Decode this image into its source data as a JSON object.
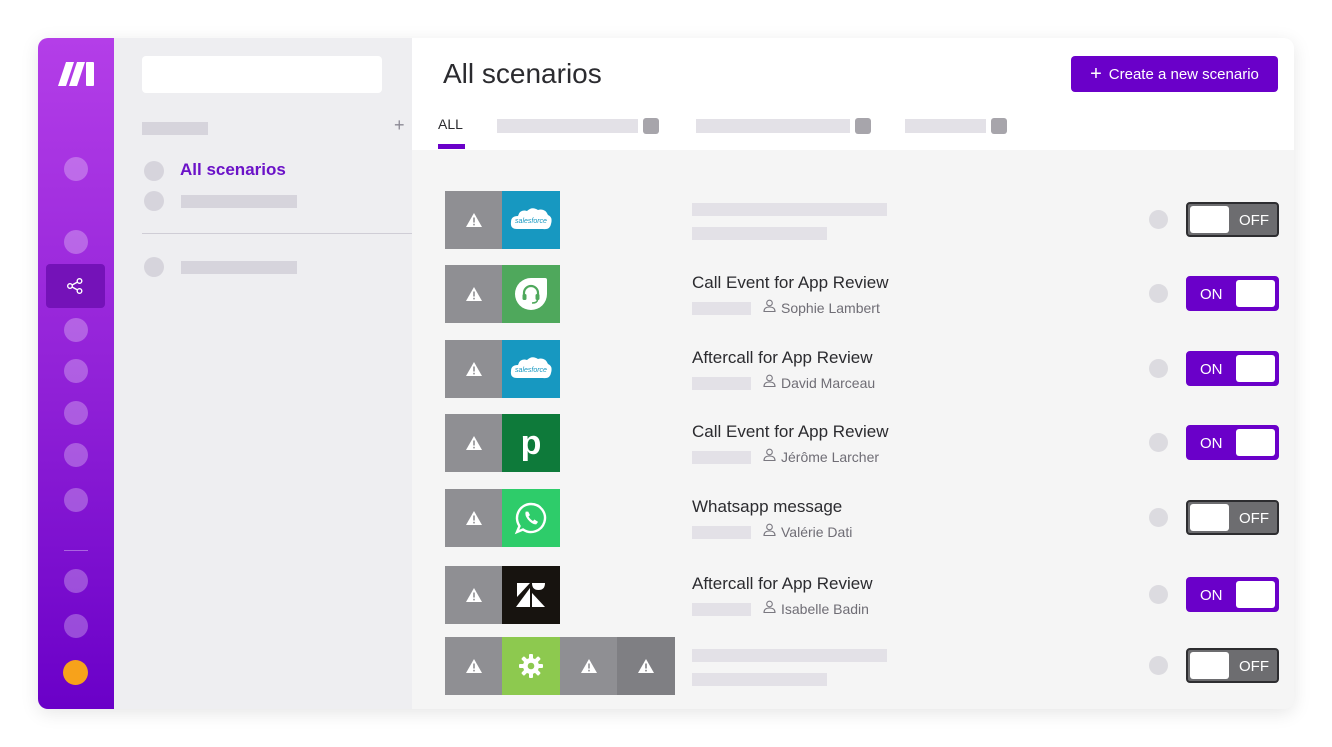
{
  "rail": {
    "logo_icon": "make-logo-icon",
    "active_item_icon": "share-network-icon",
    "accent_color": "#6a00c9",
    "user_color": "#f7a21b"
  },
  "folders": {
    "add_icon": "plus-icon",
    "active_label": "All scenarios"
  },
  "header": {
    "title": "All scenarios",
    "create_button_label": "Create a new scenario",
    "create_button_icon": "plus-icon",
    "tabs": [
      {
        "label": "ALL",
        "active": true
      }
    ]
  },
  "scenarios": [
    {
      "apps": [
        "warning-icon",
        "salesforce-icon"
      ],
      "name": "",
      "author": "",
      "status": "OFF"
    },
    {
      "apps": [
        "warning-icon",
        "freshdesk-icon"
      ],
      "name": "Call Event for App Review",
      "author": "Sophie Lambert",
      "status": "ON"
    },
    {
      "apps": [
        "warning-icon",
        "salesforce-icon"
      ],
      "name": "Aftercall for App Review",
      "author": "David Marceau",
      "status": "ON"
    },
    {
      "apps": [
        "warning-icon",
        "pipedrive-icon"
      ],
      "name": "Call Event for App Review",
      "author": "Jérôme Larcher",
      "status": "ON"
    },
    {
      "apps": [
        "warning-icon",
        "whatsapp-icon"
      ],
      "name": "Whatsapp message",
      "author": "Valérie Dati",
      "status": "OFF"
    },
    {
      "apps": [
        "warning-icon",
        "zendesk-icon"
      ],
      "name": "Aftercall for App Review",
      "author": "Isabelle Badin",
      "status": "ON"
    },
    {
      "apps": [
        "warning-icon",
        "gear-icon",
        "warning-icon",
        "warning-icon"
      ],
      "name": "",
      "author": "",
      "status": "OFF"
    }
  ],
  "icons": {
    "salesforce_text": "salesforce",
    "pipedrive_letter": "p"
  }
}
